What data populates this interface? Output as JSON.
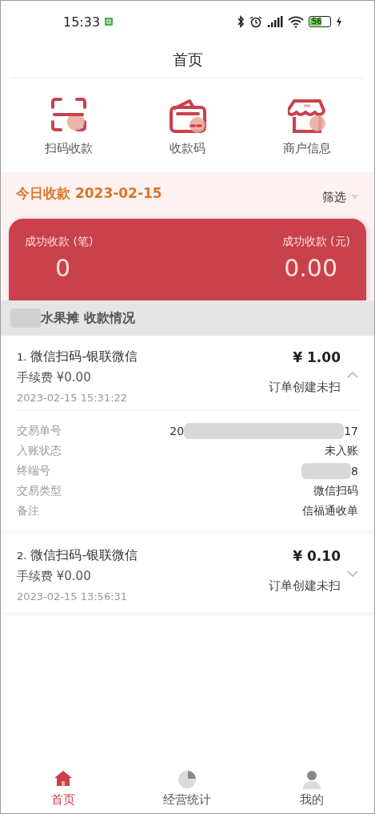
{
  "status_bar": {
    "time": "15:33",
    "battery": "56"
  },
  "title": "首页",
  "quick_actions": [
    {
      "label": "扫码收款",
      "kind": "scan"
    },
    {
      "label": "收款码",
      "kind": "wallet"
    },
    {
      "label": "商户信息",
      "kind": "shop"
    }
  ],
  "today": {
    "title": "今日收款 2023-02-15",
    "filter": "筛选"
  },
  "summary": [
    {
      "label": "成功收款 (笔)",
      "value": "0"
    },
    {
      "label": "成功收款 (元)",
      "value": "0.00"
    }
  ],
  "section_title": {
    "text": "水果摊 收款情况",
    "redacted": true
  },
  "transactions": [
    {
      "index": "1.",
      "title": "微信扫码-银联微信",
      "amount": "¥ 1.00",
      "fee": "手续费 ¥0.00",
      "status": "订单创建未扫",
      "time": "2023-02-15 15:31:22",
      "expanded": true,
      "details": [
        {
          "label": "交易单号",
          "value": "20",
          "value_end": "17",
          "redacted": true
        },
        {
          "label": "入账状态",
          "value": "未入账",
          "redacted": false
        },
        {
          "label": "终端号",
          "value_end": "8",
          "redacted": true
        },
        {
          "label": "交易类型",
          "value": "微信扫码",
          "redacted": false
        },
        {
          "label": "备注",
          "value": "信福通收单",
          "redacted": false
        }
      ]
    },
    {
      "index": "2.",
      "title": "微信扫码-银联微信",
      "amount": "¥ 0.10",
      "fee": "手续费 ¥0.00",
      "status": "订单创建未扫",
      "time": "2023-02-15 13:56:31",
      "expanded": false
    }
  ],
  "tab_bar": [
    {
      "label": "首页",
      "kind": "home",
      "selected": true
    },
    {
      "label": "经营统计",
      "kind": "stats",
      "selected": false
    },
    {
      "label": "我的",
      "kind": "profile",
      "selected": false
    }
  ]
}
